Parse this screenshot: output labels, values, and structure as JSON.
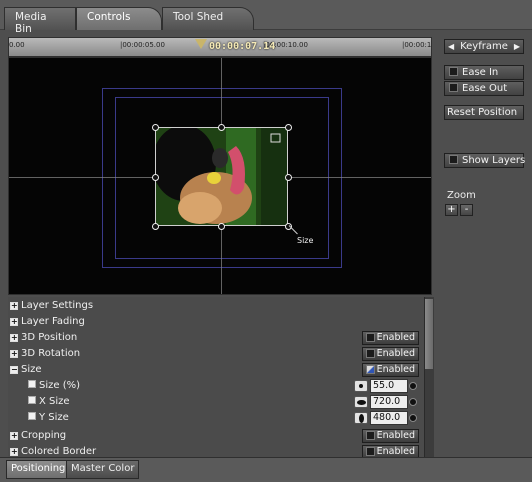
{
  "tabs": [
    "Media Bin",
    "Controls",
    "Tool Shed"
  ],
  "ruler": {
    "ticks": [
      "0.00",
      "|00:00:05.00",
      "|00:00:10.00",
      "|00:00:1"
    ],
    "timecode": "00:00:07.14"
  },
  "viewer": {
    "size_label": "Size"
  },
  "side": {
    "keyframe": "Keyframe",
    "ease_in": "Ease In",
    "ease_out": "Ease Out",
    "reset_position": "Reset Position",
    "show_layers": "Show Layers",
    "zoom_label": "Zoom",
    "zoom_in": "+",
    "zoom_out": "-"
  },
  "props": {
    "rows": [
      {
        "label": "Layer Settings"
      },
      {
        "label": "Layer Fading"
      },
      {
        "label": "3D Position",
        "button": "Enabled"
      },
      {
        "label": "3D Rotation",
        "button": "Enabled"
      },
      {
        "label": "Size",
        "button": "Enabled"
      },
      {
        "label": "Size (%)",
        "value": "55.0"
      },
      {
        "label": "X Size",
        "value": "720.0"
      },
      {
        "label": "Y Size",
        "value": "480.0"
      },
      {
        "label": "Cropping",
        "button": "Enabled"
      },
      {
        "label": "Colored Border",
        "button": "Enabled"
      }
    ]
  },
  "bottom_tabs": [
    "Positioning",
    "Master Color"
  ]
}
